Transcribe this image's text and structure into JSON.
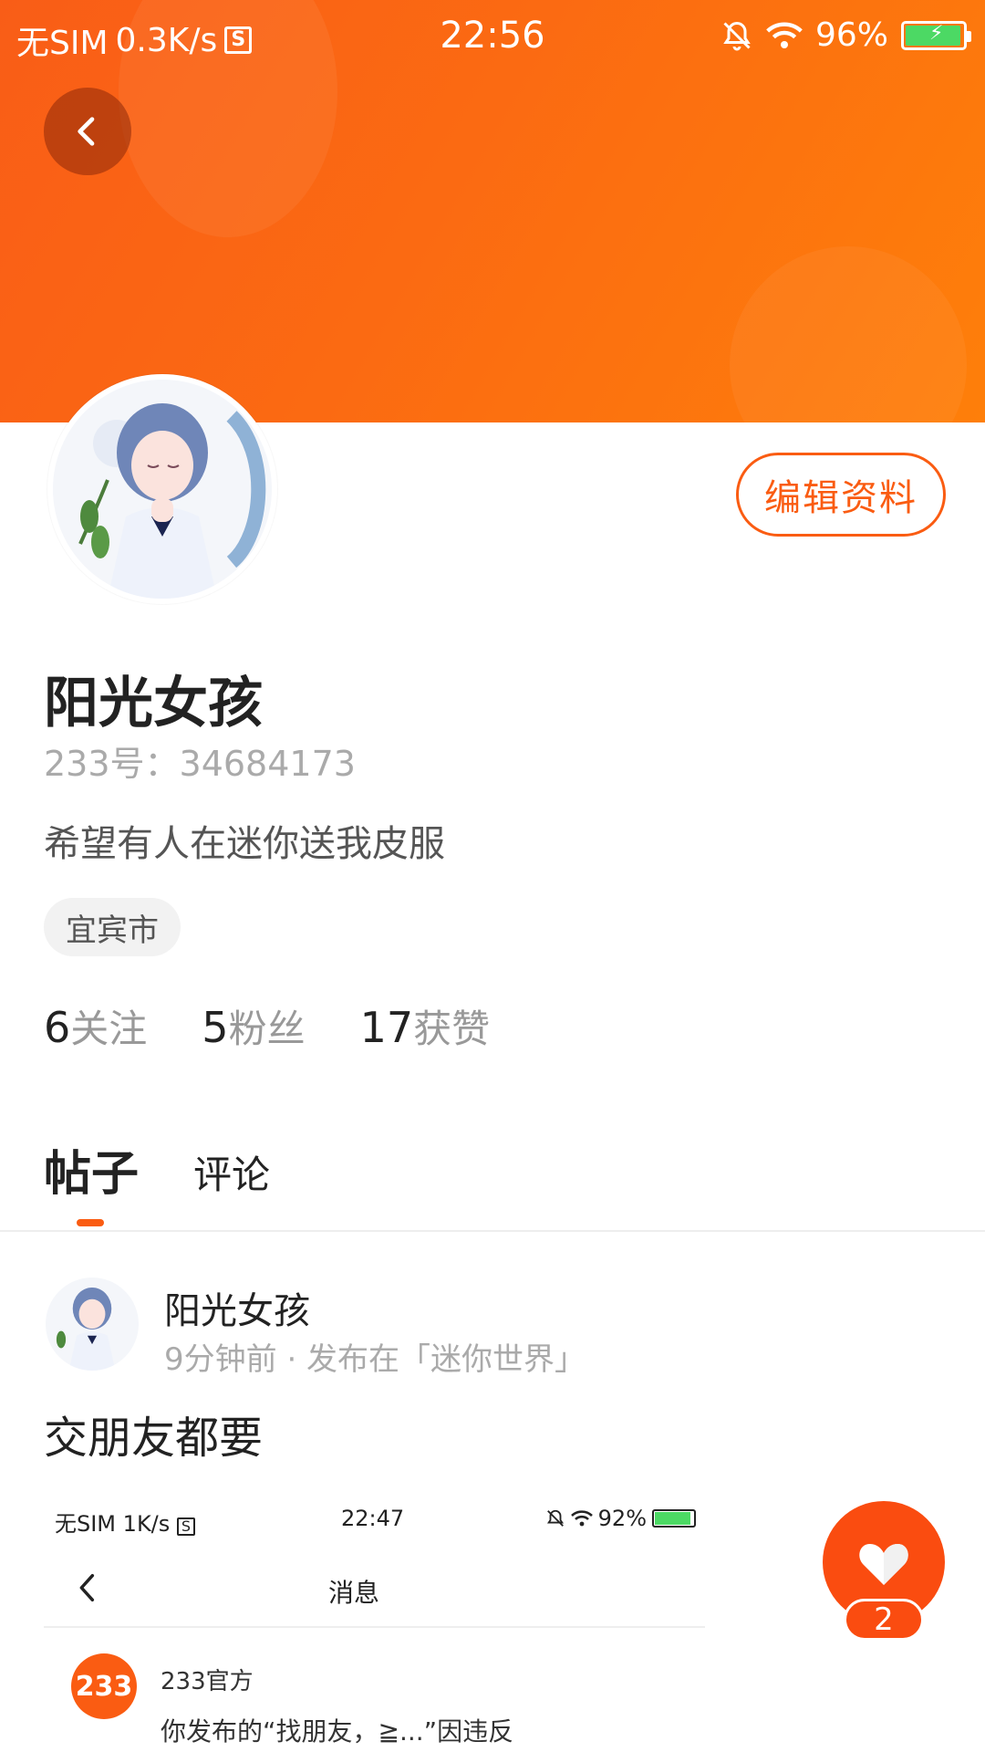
{
  "status_bar": {
    "carrier": "无SIM",
    "speed": "0.3K/s",
    "sim_glyph": "S",
    "time": "22:56",
    "battery": "96%",
    "icons": [
      "mute-bell-icon",
      "wifi-icon",
      "battery-icon"
    ]
  },
  "colors": {
    "accent": "#fa5c12",
    "banner_start": "#f95d17",
    "banner_end": "#fe7f0a"
  },
  "profile": {
    "edit_label": "编辑资料",
    "name": "阳光女孩",
    "uid": "233号：34684173",
    "bio": "希望有人在迷你送我皮服",
    "location_tag": "宜宾市",
    "stats": {
      "following_num": "6",
      "following_label": "关注",
      "fans_num": "5",
      "fans_label": "粉丝",
      "likes_num": "17",
      "likes_label": "获赞"
    }
  },
  "tabs": {
    "posts": "帖子",
    "comments": "评论"
  },
  "post": {
    "author": "阳光女孩",
    "meta": "9分钟前 · 发布在「迷你世界」",
    "title": "交朋友都要",
    "screenshot": {
      "carrier": "无SIM",
      "speed": "1K/s",
      "sim_glyph": "S",
      "time": "22:47",
      "battery": "92%",
      "nav_title": "消息",
      "sender_logo": "233",
      "sender": "233官方",
      "message": "你发布的“找朋友，≧...”因违反"
    }
  },
  "like": {
    "count": "2"
  }
}
